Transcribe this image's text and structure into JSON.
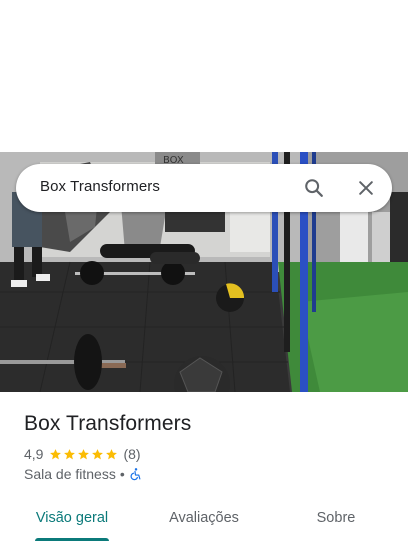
{
  "search": {
    "query": "Box Transformers"
  },
  "place": {
    "name": "Box Transformers",
    "rating": "4,9",
    "review_count": "(8)",
    "stars": 5,
    "category": "Sala de fitness",
    "separator": "•"
  },
  "tabs": [
    {
      "label": "Visão geral",
      "active": true
    },
    {
      "label": "Avaliações",
      "active": false
    },
    {
      "label": "Sobre",
      "active": false
    }
  ],
  "photo": {
    "sign_text": "BOX"
  },
  "colors": {
    "accent": "#0b7a7a",
    "star": "#fbbc04",
    "accessibility_icon": "#1a73e8"
  },
  "icons": [
    "search-icon",
    "close-icon",
    "star-icon",
    "wheelchair-icon"
  ]
}
